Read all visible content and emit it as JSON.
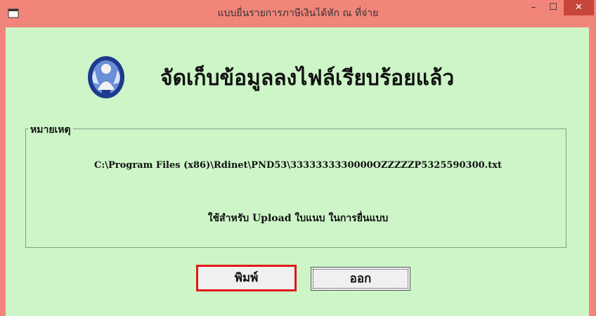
{
  "window": {
    "title": "แบบยื่นรายการภาษีเงินได้หัก ณ ที่จ่าย",
    "minimize_glyph": "–",
    "maximize_glyph": "☐",
    "close_glyph": "✕",
    "titlebar_color": "#f2857a",
    "background_color": "#cdf5c8"
  },
  "main": {
    "headline": "จัดเก็บข้อมูลลงไฟล์เรียบร้อยแล้ว",
    "emblem_icon": "thai-revenue-department-emblem"
  },
  "remarks": {
    "legend": "หมายเหตุ",
    "file_path": "C:\\Program Files (x86)\\Rdinet\\PND53\\3333333330000OZZZZZP5325590300.txt",
    "note": "ใช้สำหรับ Upload ใบแนบ ในการยื่นแบบ"
  },
  "buttons": {
    "print_label": "พิมพ์",
    "exit_label": "ออก",
    "print_highlight_color": "#e01818"
  }
}
